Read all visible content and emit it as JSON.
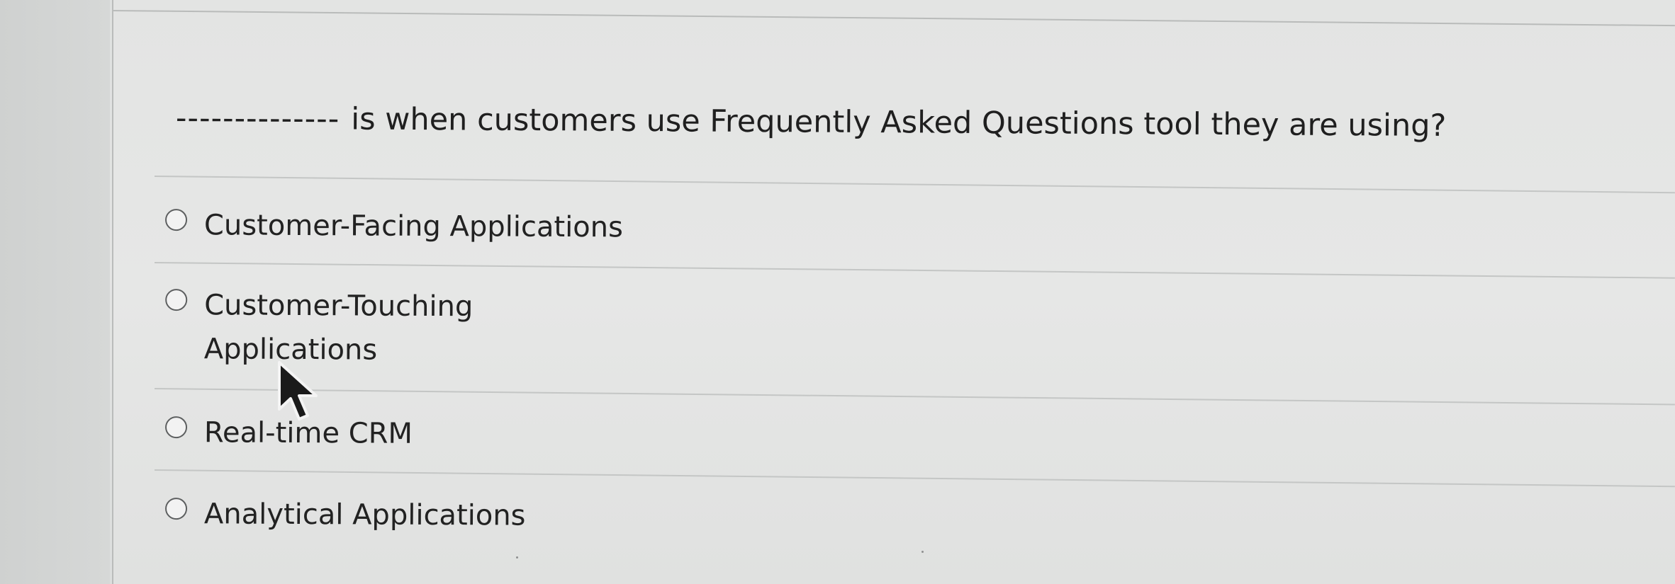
{
  "question": {
    "blank": "--------------",
    "text": "is when customers use Frequently Asked Questions tool they are using?"
  },
  "options": [
    {
      "label": "Customer-Facing Applications",
      "selected": false
    },
    {
      "label": "Customer-Touching Applications",
      "selected": false
    },
    {
      "label": "Real-time CRM",
      "selected": false
    },
    {
      "label": "Analytical Applications",
      "selected": false
    }
  ],
  "cursor": {
    "icon": "mouse-pointer-icon",
    "color": "#1a1a1a"
  }
}
